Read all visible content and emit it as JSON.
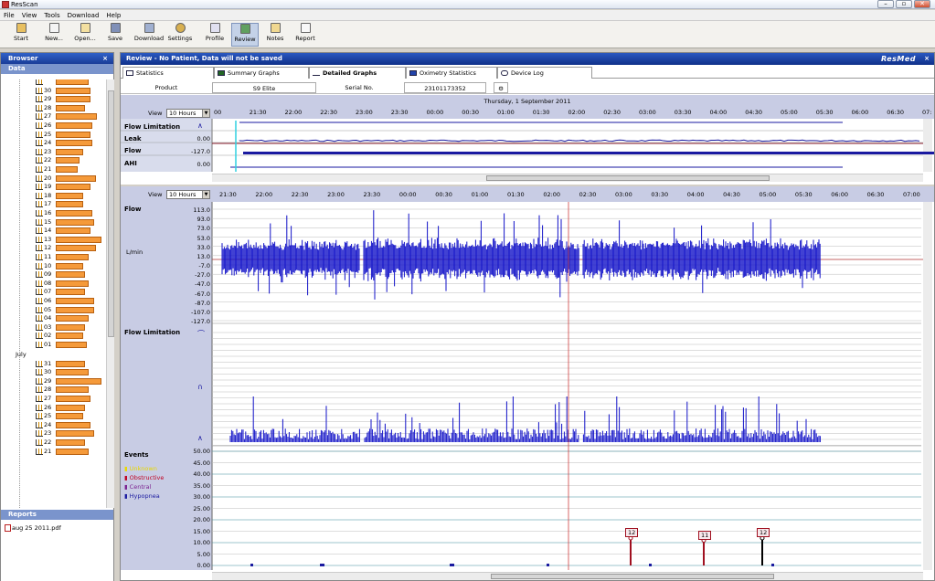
{
  "window": {
    "title": "ResScan",
    "controls": [
      "–",
      "▫",
      "✕"
    ]
  },
  "menu": [
    "File",
    "View",
    "Tools",
    "Download",
    "Help"
  ],
  "toolbar": [
    {
      "id": "start",
      "label": "Start",
      "icon": "start-icon"
    },
    {
      "id": "new",
      "label": "New...",
      "icon": "new-icon"
    },
    {
      "id": "open",
      "label": "Open...",
      "icon": "open-icon"
    },
    {
      "id": "save",
      "label": "Save",
      "icon": "save-icon"
    },
    {
      "id": "download",
      "label": "Download",
      "icon": "download-icon"
    },
    {
      "id": "settings",
      "label": "Settings",
      "icon": "settings-icon"
    },
    {
      "id": "profile",
      "label": "Profile",
      "icon": "profile-icon"
    },
    {
      "id": "review",
      "label": "Review",
      "icon": "review-icon",
      "active": true
    },
    {
      "id": "notes",
      "label": "Notes",
      "icon": "notes-icon"
    },
    {
      "id": "report",
      "label": "Report",
      "icon": "report-icon"
    }
  ],
  "browser": {
    "title": "Browser",
    "data_label": "Data",
    "month_label": "July",
    "august_days": [
      {
        "d": "",
        "bar": 36
      },
      {
        "d": "30",
        "bar": 38
      },
      {
        "d": "29",
        "bar": 38
      },
      {
        "d": "28",
        "bar": 32
      },
      {
        "d": "27",
        "bar": 45
      },
      {
        "d": "26",
        "bar": 40
      },
      {
        "d": "25",
        "bar": 38
      },
      {
        "d": "24",
        "bar": 40
      },
      {
        "d": "23",
        "bar": 30
      },
      {
        "d": "22",
        "bar": 26
      },
      {
        "d": "21",
        "bar": 24
      },
      {
        "d": "20",
        "bar": 44
      },
      {
        "d": "19",
        "bar": 38
      },
      {
        "d": "18",
        "bar": 30
      },
      {
        "d": "17",
        "bar": 30
      },
      {
        "d": "16",
        "bar": 40
      },
      {
        "d": "15",
        "bar": 42
      },
      {
        "d": "14",
        "bar": 38
      },
      {
        "d": "13",
        "bar": 50
      },
      {
        "d": "12",
        "bar": 44
      },
      {
        "d": "11",
        "bar": 36
      },
      {
        "d": "10",
        "bar": 30
      },
      {
        "d": "09",
        "bar": 32
      },
      {
        "d": "08",
        "bar": 36
      },
      {
        "d": "07",
        "bar": 32
      },
      {
        "d": "06",
        "bar": 42
      },
      {
        "d": "05",
        "bar": 42
      },
      {
        "d": "04",
        "bar": 36
      },
      {
        "d": "03",
        "bar": 32
      },
      {
        "d": "02",
        "bar": 30
      },
      {
        "d": "01",
        "bar": 34
      }
    ],
    "july_days": [
      {
        "d": "31",
        "bar": 32
      },
      {
        "d": "30",
        "bar": 36
      },
      {
        "d": "29",
        "bar": 50
      },
      {
        "d": "28",
        "bar": 36
      },
      {
        "d": "27",
        "bar": 38
      },
      {
        "d": "26",
        "bar": 32
      },
      {
        "d": "25",
        "bar": 30
      },
      {
        "d": "24",
        "bar": 38
      },
      {
        "d": "23",
        "bar": 42
      },
      {
        "d": "22",
        "bar": 32
      },
      {
        "d": "21",
        "bar": 36
      }
    ],
    "reports_title": "Reports",
    "report_file": "aug 25 2011.pdf",
    "close": "×"
  },
  "review": {
    "header": "Review - No Patient, Data will not be saved",
    "logo": "ResMed",
    "close": "×",
    "tabs": [
      {
        "label": "Statistics",
        "icon": "statistics-icon"
      },
      {
        "label": "Summary Graphs",
        "icon": "summary-graphs-icon"
      },
      {
        "label": "Detailed Graphs",
        "icon": "detailed-graphs-icon",
        "selected": true
      },
      {
        "label": "Oximetry Statistics",
        "icon": "oximetry-icon"
      },
      {
        "label": "Device Log",
        "icon": "device-log-icon"
      }
    ],
    "product_label": "Product",
    "product_value": "S9 Elite",
    "serial_label": "Serial No.",
    "serial_value": "23101173352"
  },
  "overview": {
    "date": "Thursday, 1 September 2011",
    "view_label": "View",
    "view_value": "10 Hours",
    "ticks": [
      "00",
      "21:30",
      "22:00",
      "22:30",
      "23:00",
      "23:30",
      "00:00",
      "00:30",
      "01:00",
      "01:30",
      "02:00",
      "02:30",
      "03:00",
      "03:30",
      "04:00",
      "04:30",
      "05:00",
      "05:30",
      "06:00",
      "06:30",
      "07:"
    ],
    "rows": [
      {
        "label": "Flow Limitation",
        "value": ""
      },
      {
        "label": "Leak",
        "value": "0.00"
      },
      {
        "label": "Flow",
        "value": "-127.0"
      },
      {
        "label": "AHI",
        "value": "0.00"
      }
    ]
  },
  "detail": {
    "view_label": "View",
    "view_value": "10 Hours",
    "ticks": [
      "21:30",
      "22:00",
      "22:30",
      "23:00",
      "23:30",
      "00:00",
      "00:30",
      "01:00",
      "01:30",
      "02:00",
      "02:30",
      "03:00",
      "03:30",
      "04:00",
      "04:30",
      "05:00",
      "05:30",
      "06:00",
      "06:30",
      "07:00"
    ],
    "flow": {
      "label": "Flow",
      "unit": "L/min",
      "yticks": [
        "113.0",
        "93.0",
        "73.0",
        "53.0",
        "33.0",
        "13.0",
        "-7.0",
        "-27.0",
        "-47.0",
        "-67.0",
        "-87.0",
        "-107.0",
        "-127.0"
      ]
    },
    "flow_limitation": {
      "label": "Flow Limitation"
    },
    "events": {
      "label": "Events",
      "legend": [
        {
          "name": "Unknown",
          "color": "#e8d800"
        },
        {
          "name": "Obstructive",
          "color": "#c00020"
        },
        {
          "name": "Central",
          "color": "#7a2090"
        },
        {
          "name": "Hypopnea",
          "color": "#1a1aa0"
        }
      ],
      "yticks": [
        "50.00",
        "45.00",
        "40.00",
        "35.00",
        "30.00",
        "25.00",
        "20.00",
        "15.00",
        "10.00",
        "5.00",
        "0.00"
      ],
      "markers": [
        {
          "type": "Obstructive",
          "value": 12,
          "label": "12",
          "time": "03:05"
        },
        {
          "type": "Obstructive",
          "value": 11,
          "label": "11",
          "time": "04:00"
        },
        {
          "type": "Central",
          "value": 12,
          "label": "12",
          "time": "04:50"
        }
      ]
    }
  }
}
